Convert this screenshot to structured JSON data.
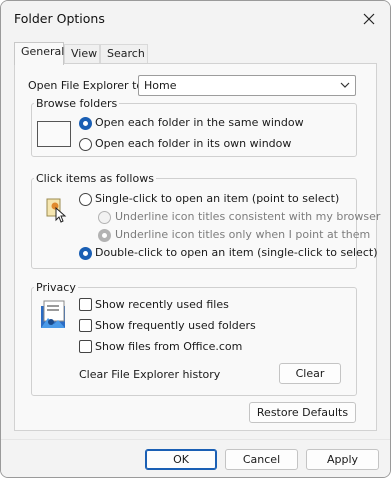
{
  "window": {
    "title": "Folder Options"
  },
  "tabs": [
    {
      "label": "General",
      "active": true
    },
    {
      "label": "View",
      "active": false
    },
    {
      "label": "Search",
      "active": false
    }
  ],
  "general": {
    "open_with_label": "Open File Explorer to:",
    "open_with_value": "Home",
    "browse": {
      "legend": "Browse folders",
      "options": [
        {
          "label": "Open each folder in the same window",
          "checked": true
        },
        {
          "label": "Open each folder in its own window",
          "checked": false
        }
      ]
    },
    "click": {
      "legend": "Click items as follows",
      "single": {
        "label": "Single-click to open an item (point to select)",
        "checked": false
      },
      "sub_options": [
        {
          "label": "Underline icon titles consistent with my browser",
          "checked": false,
          "disabled": true
        },
        {
          "label": "Underline icon titles only when I point at them",
          "checked": true,
          "disabled": true
        }
      ],
      "double": {
        "label": "Double-click to open an item (single-click to select)",
        "checked": true
      }
    },
    "privacy": {
      "legend": "Privacy",
      "checkboxes": [
        {
          "label": "Show recently used files",
          "checked": false
        },
        {
          "label": "Show frequently used folders",
          "checked": false
        },
        {
          "label": "Show files from Office.com",
          "checked": false
        }
      ],
      "clear_label": "Clear File Explorer history",
      "clear_button": "Clear"
    },
    "restore_defaults": "Restore Defaults"
  },
  "footer": {
    "ok": "OK",
    "cancel": "Cancel",
    "apply": "Apply"
  },
  "colors": {
    "accent": "#1a5fb4",
    "background": "#f3f3f3",
    "panel": "#f9f9f9"
  }
}
